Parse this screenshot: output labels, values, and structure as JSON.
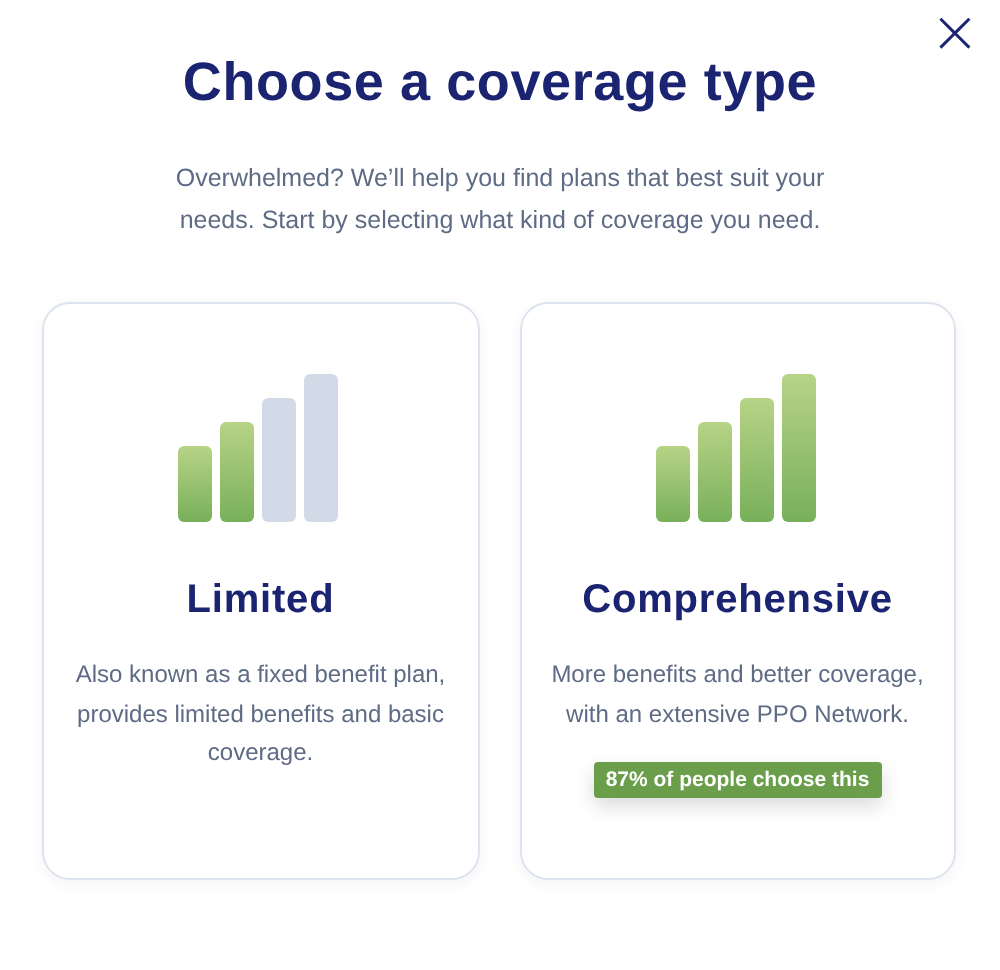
{
  "close": "×",
  "title": "Choose a coverage type",
  "subtitle": "Overwhelmed? We’ll help you find plans that best suit your needs. Start by selecting what kind of coverage you need.",
  "options": [
    {
      "name": "Limited",
      "kind": "partial",
      "description": "Also known as a fixed benefit plan, provides limited benefits and basic coverage."
    },
    {
      "name": "Comprehensive",
      "kind": "full",
      "description": "More benefits and better coverage, with an extensive PPO Network.",
      "badge": "87% of people choose this"
    }
  ]
}
